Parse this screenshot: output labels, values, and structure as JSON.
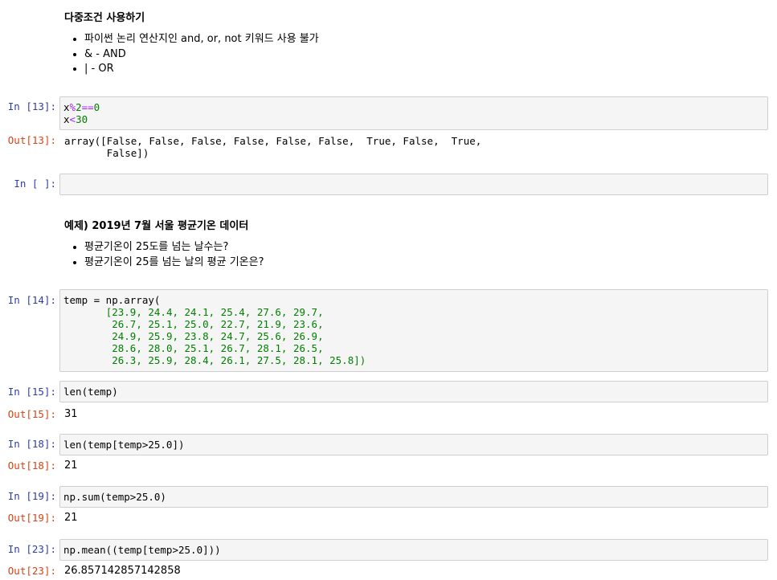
{
  "md1": {
    "title": "다중조건 사용하기",
    "items": [
      "파이썬 논리 연산지인 and, or, not 키워드 사용 불가",
      "& - AND",
      "| - OR"
    ]
  },
  "cell13": {
    "in_prompt": "In [13]:",
    "line1_a": "x",
    "line1_op": "%",
    "line1_b": "2",
    "line1_op2": "==",
    "line1_c": "0",
    "line2_a": "x",
    "line2_op": "<",
    "line2_b": "30",
    "out_prompt": "Out[13]:",
    "output": "array([False, False, False, False, False, False,  True, False,  True,\n       False])"
  },
  "cell_empty": {
    "in_prompt": "In [ ]:"
  },
  "md2": {
    "title": "예제) 2019년 7월 서울 평균기온 데이터",
    "items": [
      "평균기온이 25도를 넘는 날수는?",
      "평균기온이 25를 넘는 날의 평균 기온은?"
    ]
  },
  "cell14": {
    "in_prompt": "In [14]:",
    "line1": "temp = np.array(",
    "rows": [
      "[23.9, 24.4, 24.1, 25.4, 27.6, 29.7,",
      " 26.7, 25.1, 25.0, 22.7, 21.9, 23.6,",
      " 24.9, 25.9, 23.8, 24.7, 25.6, 26.9,",
      " 28.6, 28.0, 25.1, 26.7, 28.1, 26.5,",
      " 26.3, 25.9, 28.4, 26.1, 27.5, 28.1, 25.8])"
    ]
  },
  "cell15": {
    "in_prompt": "In [15]:",
    "code": "len(temp)",
    "out_prompt": "Out[15]:",
    "output": "31"
  },
  "cell18": {
    "in_prompt": "In [18]:",
    "code": "len(temp[temp>25.0])",
    "out_prompt": "Out[18]:",
    "output": "21"
  },
  "cell19": {
    "in_prompt": "In [19]:",
    "code": "np.sum(temp>25.0)",
    "out_prompt": "Out[19]:",
    "output": "21"
  },
  "cell23": {
    "in_prompt": "In [23]:",
    "code": "np.mean((temp[temp>25.0]))",
    "out_prompt": "Out[23]:",
    "output": "26.857142857142858"
  }
}
